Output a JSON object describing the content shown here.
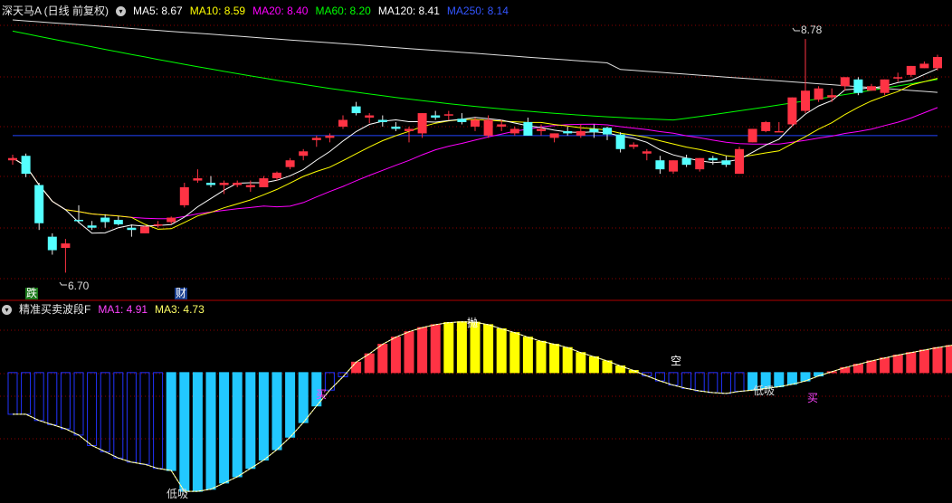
{
  "header": {
    "title": "深天马A (日线 前复权)",
    "ma": [
      {
        "label": "MA5: 8.67",
        "color": "#ffffff"
      },
      {
        "label": "MA10: 8.59",
        "color": "#ffff00"
      },
      {
        "label": "MA20: 8.40",
        "color": "#ff00ff"
      },
      {
        "label": "MA60: 8.20",
        "color": "#00ff00"
      },
      {
        "label": "MA120: 8.41",
        "color": "#ffffff"
      },
      {
        "label": "MA250: 8.14",
        "color": "#3355ff"
      }
    ]
  },
  "indicator": {
    "title": "精准买卖波段F",
    "ma": [
      {
        "label": "MA1: 4.91",
        "color": "#ff44ff"
      },
      {
        "label": "MA3: 4.73",
        "color": "#ffff66"
      }
    ]
  },
  "annotations": {
    "low_price": "6.70",
    "high_price": "8.78",
    "fall": "跌",
    "cai": "财",
    "di_xi_1": "低吸",
    "di_xi_2": "低吸",
    "mai_1": "买",
    "mai_2": "买",
    "pao": "抛",
    "kong": "空"
  },
  "colors": {
    "up": "#ff3344",
    "down": "#54ffff",
    "grid": "#8b0000",
    "divider": "#b00000"
  },
  "chart_data": [
    {
      "type": "candlestick",
      "ylim": [
        6.55,
        8.95
      ],
      "ohlc": [
        [
          7.7,
          7.75,
          7.66,
          7.72
        ],
        [
          7.74,
          7.76,
          7.55,
          7.58
        ],
        [
          7.48,
          7.5,
          7.08,
          7.14
        ],
        [
          7.02,
          7.05,
          6.86,
          6.9
        ],
        [
          6.92,
          7.0,
          6.7,
          6.96
        ],
        [
          7.17,
          7.3,
          7.14,
          7.16
        ],
        [
          7.12,
          7.16,
          7.08,
          7.1
        ],
        [
          7.19,
          7.22,
          7.1,
          7.15
        ],
        [
          7.17,
          7.2,
          7.12,
          7.13
        ],
        [
          7.1,
          7.13,
          7.02,
          7.08
        ],
        [
          7.05,
          7.12,
          7.05,
          7.11
        ],
        [
          7.12,
          7.16,
          7.1,
          7.13
        ],
        [
          7.15,
          7.2,
          7.13,
          7.19
        ],
        [
          7.3,
          7.5,
          7.28,
          7.46
        ],
        [
          7.52,
          7.62,
          7.5,
          7.54
        ],
        [
          7.5,
          7.56,
          7.46,
          7.48
        ],
        [
          7.48,
          7.52,
          7.4,
          7.5
        ],
        [
          7.48,
          7.52,
          7.46,
          7.5
        ],
        [
          7.46,
          7.52,
          7.42,
          7.48
        ],
        [
          7.46,
          7.56,
          7.46,
          7.54
        ],
        [
          7.54,
          7.6,
          7.52,
          7.59
        ],
        [
          7.64,
          7.72,
          7.62,
          7.7
        ],
        [
          7.74,
          7.8,
          7.7,
          7.78
        ],
        [
          7.88,
          7.92,
          7.82,
          7.9
        ],
        [
          7.9,
          7.94,
          7.86,
          7.92
        ],
        [
          8.0,
          8.1,
          7.98,
          8.06
        ],
        [
          8.18,
          8.22,
          8.1,
          8.12
        ],
        [
          8.08,
          8.12,
          8.03,
          8.1
        ],
        [
          8.06,
          8.1,
          8.0,
          8.04
        ],
        [
          8.0,
          8.04,
          7.96,
          7.98
        ],
        [
          7.96,
          8.0,
          7.86,
          7.98
        ],
        [
          7.94,
          8.12,
          7.9,
          8.12
        ],
        [
          8.1,
          8.14,
          8.06,
          8.08
        ],
        [
          8.1,
          8.14,
          8.06,
          8.11
        ],
        [
          8.07,
          8.12,
          8.02,
          8.04
        ],
        [
          8.0,
          8.08,
          7.96,
          8.06
        ],
        [
          7.92,
          8.1,
          7.9,
          8.06
        ],
        [
          8.0,
          8.06,
          7.96,
          8.02
        ],
        [
          7.94,
          8.0,
          7.92,
          7.98
        ],
        [
          8.04,
          8.08,
          7.92,
          7.92
        ],
        [
          7.96,
          8.02,
          7.92,
          7.98
        ],
        [
          7.9,
          7.94,
          7.86,
          7.94
        ],
        [
          7.96,
          8.0,
          7.92,
          7.94
        ],
        [
          7.92,
          8.02,
          7.9,
          7.96
        ],
        [
          7.98,
          8.02,
          7.9,
          7.95
        ],
        [
          7.99,
          8.0,
          7.88,
          7.93
        ],
        [
          7.93,
          7.95,
          7.77,
          7.8
        ],
        [
          7.82,
          7.86,
          7.8,
          7.84
        ],
        [
          7.76,
          7.8,
          7.7,
          7.78
        ],
        [
          7.7,
          7.74,
          7.58,
          7.62
        ],
        [
          7.6,
          7.7,
          7.58,
          7.7
        ],
        [
          7.72,
          7.75,
          7.64,
          7.66
        ],
        [
          7.62,
          7.72,
          7.6,
          7.72
        ],
        [
          7.72,
          7.74,
          7.66,
          7.7
        ],
        [
          7.7,
          7.74,
          7.64,
          7.66
        ],
        [
          7.58,
          7.82,
          7.58,
          7.8
        ],
        [
          7.86,
          7.98,
          7.86,
          7.98
        ],
        [
          7.96,
          8.05,
          7.95,
          8.04
        ],
        [
          7.96,
          8.04,
          7.96,
          7.96
        ],
        [
          8.02,
          8.26,
          8.0,
          8.26
        ],
        [
          8.14,
          8.78,
          8.12,
          8.32
        ],
        [
          8.24,
          8.36,
          8.22,
          8.34
        ],
        [
          8.26,
          8.34,
          8.22,
          8.28
        ],
        [
          8.36,
          8.44,
          8.32,
          8.44
        ],
        [
          8.42,
          8.44,
          8.28,
          8.3
        ],
        [
          8.32,
          8.38,
          8.32,
          8.36
        ],
        [
          8.3,
          8.42,
          8.28,
          8.42
        ],
        [
          8.44,
          8.48,
          8.4,
          8.44
        ],
        [
          8.46,
          8.54,
          8.44,
          8.54
        ],
        [
          8.52,
          8.58,
          8.52,
          8.56
        ],
        [
          8.52,
          8.64,
          8.5,
          8.62
        ]
      ]
    },
    {
      "type": "bar",
      "ylim": [
        -3.0,
        1.3
      ],
      "values": [
        -1.0,
        -1.0,
        -1.15,
        -1.25,
        -1.35,
        -1.5,
        -1.75,
        -1.9,
        -2.05,
        -2.15,
        -2.2,
        -2.3,
        -2.35,
        -2.85,
        -2.85,
        -2.8,
        -2.65,
        -2.5,
        -2.3,
        -2.1,
        -1.85,
        -1.55,
        -1.2,
        -0.8,
        -0.42,
        -0.1,
        0.25,
        0.45,
        0.68,
        0.85,
        0.98,
        1.08,
        1.15,
        1.2,
        1.22,
        1.21,
        1.15,
        1.05,
        0.96,
        0.85,
        0.75,
        0.68,
        0.6,
        0.48,
        0.38,
        0.28,
        0.16,
        0.05,
        -0.08,
        -0.2,
        -0.3,
        -0.38,
        -0.44,
        -0.48,
        -0.5,
        -0.45,
        -0.42,
        -0.38,
        -0.34,
        -0.28,
        -0.2,
        -0.08,
        0.02,
        0.12,
        0.2,
        0.28,
        0.35,
        0.42,
        0.48,
        0.54,
        0.6,
        0.65,
        0.7,
        0.75,
        0.8
      ]
    }
  ]
}
